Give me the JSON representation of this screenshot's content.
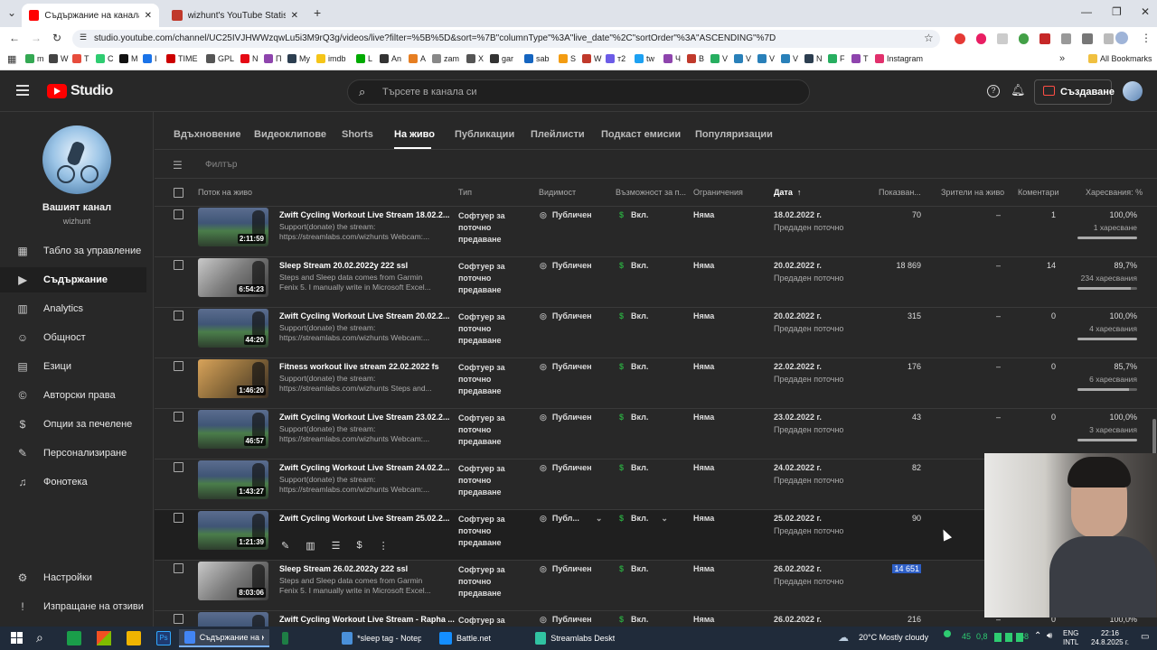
{
  "browser": {
    "tabs": [
      {
        "title": "Съдържание на канала - YouT",
        "color": "#ff0000"
      },
      {
        "title": "wizhunt's YouTube Statistics - S",
        "color": "#c0392b"
      }
    ],
    "url": "studio.youtube.com/channel/UC25IVJHWWzqwLu5i3M9rQ3g/videos/live?filter=%5B%5D&sort=%7B\"columnType\"%3A\"live_date\"%2C\"sortOrder\"%3A\"ASCENDING\"%7D",
    "bookmarks": [
      {
        "label": "m",
        "color": "#34a853"
      },
      {
        "label": "W",
        "color": "#444"
      },
      {
        "label": "T",
        "color": "#e74c3c"
      },
      {
        "label": "C",
        "color": "#2ecc71"
      },
      {
        "label": "M",
        "color": "#111"
      },
      {
        "label": "I",
        "color": "#1a73e8"
      },
      {
        "label": "TIME",
        "color": "#c00"
      },
      {
        "label": "GPL",
        "color": "#555"
      },
      {
        "label": "N",
        "color": "#e50914"
      },
      {
        "label": "П",
        "color": "#8e44ad"
      },
      {
        "label": "My",
        "color": "#2c3e50"
      },
      {
        "label": "imdb",
        "color": "#f5c518"
      },
      {
        "label": "L",
        "color": "#0a0"
      },
      {
        "label": "An",
        "color": "#333"
      },
      {
        "label": "A",
        "color": "#e67e22"
      },
      {
        "label": "zam",
        "color": "#888"
      },
      {
        "label": "X",
        "color": "#555"
      },
      {
        "label": "gar",
        "color": "#333"
      },
      {
        "label": "sab",
        "color": "#1565c0"
      },
      {
        "label": "S",
        "color": "#f39c12"
      },
      {
        "label": "W",
        "color": "#c0392b"
      },
      {
        "label": "т2",
        "color": "#6c5ce7"
      },
      {
        "label": "tw",
        "color": "#1da1f2"
      },
      {
        "label": "Ч",
        "color": "#8e44ad"
      },
      {
        "label": "В",
        "color": "#c0392b"
      },
      {
        "label": "V",
        "color": "#27ae60"
      },
      {
        "label": "V",
        "color": "#2980b9"
      },
      {
        "label": "V",
        "color": "#2980b9"
      },
      {
        "label": "V",
        "color": "#2980b9"
      },
      {
        "label": "N",
        "color": "#2c3e50"
      },
      {
        "label": "F",
        "color": "#27ae60"
      },
      {
        "label": "T",
        "color": "#8e44ad"
      },
      {
        "label": "Instagram",
        "color": "#e1306c"
      }
    ],
    "all_bookmarks": "All Bookmarks"
  },
  "studio": {
    "logo": "Studio",
    "search_placeholder": "Търсете в канала си",
    "create_label": "Създаване"
  },
  "channel": {
    "title": "Вашият канал",
    "handle": "wizhunt"
  },
  "nav": [
    {
      "label": "Табло за управление",
      "icon": "▦",
      "active": false
    },
    {
      "label": "Съдържание",
      "icon": "▶",
      "active": true
    },
    {
      "label": "Analytics",
      "icon": "▥",
      "active": false
    },
    {
      "label": "Общност",
      "icon": "☺",
      "active": false
    },
    {
      "label": "Езици",
      "icon": "▤",
      "active": false
    },
    {
      "label": "Авторски права",
      "icon": "©",
      "active": false
    },
    {
      "label": "Опции за печелене",
      "icon": "$",
      "active": false
    },
    {
      "label": "Персонализиране",
      "icon": "✎",
      "active": false
    },
    {
      "label": "Фонотека",
      "icon": "♫",
      "active": false
    }
  ],
  "nav_bottom": [
    {
      "label": "Настройки",
      "icon": "⚙"
    },
    {
      "label": "Изпращане на отзиви",
      "icon": "!"
    }
  ],
  "content_tabs": [
    "Вдъхновение",
    "Видеоклипове",
    "Shorts",
    "На живо",
    "Публикации",
    "Плейлисти",
    "Подкаст емисии",
    "Популяризации"
  ],
  "active_tab": "На живо",
  "filter_placeholder": "Филтър",
  "columns": {
    "stream": "Поток на живо",
    "type": "Тип",
    "visibility": "Видимост",
    "monetization": "Възможност за п...",
    "restrictions": "Ограничения",
    "date": "Дата",
    "views": "Показван...",
    "live_viewers": "Зрители на живо",
    "comments": "Коментари",
    "likes": "Харесвания: %"
  },
  "rows": [
    {
      "title": "Zwift Cycling Workout Live Stream 18.02.2...",
      "desc": "Support(donate) the stream: https://streamlabs.com/wizhunts Webcam:...",
      "duration": "2:11:59",
      "type": "Софтуер за поточно предаване",
      "visibility": "Публичен",
      "monetization": "Вкл.",
      "restrictions": "Няма",
      "date": "18.02.2022 г.",
      "date_sub": "Предаден поточно",
      "views": "70",
      "live": "–",
      "comments": "1",
      "likes": "100,0%",
      "likes_sub": "1 харесване",
      "like_frac": 1.0,
      "thumb": "zwift"
    },
    {
      "title": "Sleep Stream 20.02.2022y 222 ssl",
      "desc": "Steps and Sleep data comes from Garmin Fenix 5. I manually write in Microsoft Excel...",
      "duration": "6:54:23",
      "type": "Софтуер за поточно предаване",
      "visibility": "Публичен",
      "monetization": "Вкл.",
      "restrictions": "Няма",
      "date": "20.02.2022 г.",
      "date_sub": "Предаден поточно",
      "views": "18 869",
      "live": "–",
      "comments": "14",
      "likes": "89,7%",
      "likes_sub": "234 харесвания",
      "like_frac": 0.897,
      "thumb": "sleep"
    },
    {
      "title": "Zwift Cycling Workout Live Stream 20.02.2...",
      "desc": "Support(donate) the stream: https://streamlabs.com/wizhunts Webcam:...",
      "duration": "44:20",
      "type": "Софтуер за поточно предаване",
      "visibility": "Публичен",
      "monetization": "Вкл.",
      "restrictions": "Няма",
      "date": "20.02.2022 г.",
      "date_sub": "Предаден поточно",
      "views": "315",
      "live": "–",
      "comments": "0",
      "likes": "100,0%",
      "likes_sub": "4 харесвания",
      "like_frac": 1.0,
      "thumb": "zwift"
    },
    {
      "title": "Fitness workout live stream 22.02.2022 fs",
      "desc": "Support(donate) the stream: https://streamlabs.com/wizhunts Steps and...",
      "duration": "1:46:20",
      "type": "Софтуер за поточно предаване",
      "visibility": "Публичен",
      "monetization": "Вкл.",
      "restrictions": "Няма",
      "date": "22.02.2022 г.",
      "date_sub": "Предаден поточно",
      "views": "176",
      "live": "–",
      "comments": "0",
      "likes": "85,7%",
      "likes_sub": "6 харесвания",
      "like_frac": 0.857,
      "thumb": "fitness"
    },
    {
      "title": "Zwift Cycling Workout Live Stream 23.02.2...",
      "desc": "Support(donate) the stream: https://streamlabs.com/wizhunts Webcam:...",
      "duration": "46:57",
      "type": "Софтуер за поточно предаване",
      "visibility": "Публичен",
      "monetization": "Вкл.",
      "restrictions": "Няма",
      "date": "23.02.2022 г.",
      "date_sub": "Предаден поточно",
      "views": "43",
      "live": "–",
      "comments": "0",
      "likes": "100,0%",
      "likes_sub": "3 харесвания",
      "like_frac": 1.0,
      "thumb": "zwift"
    },
    {
      "title": "Zwift Cycling Workout Live Stream 24.02.2...",
      "desc": "Support(donate) the stream: https://streamlabs.com/wizhunts Webcam:...",
      "duration": "1:43:27",
      "type": "Софтуер за поточно предаване",
      "visibility": "Публичен",
      "monetization": "Вкл.",
      "restrictions": "Няма",
      "date": "24.02.2022 г.",
      "date_sub": "Предаден поточно",
      "views": "82",
      "live": "",
      "comments": "",
      "likes": "",
      "likes_sub": "",
      "like_frac": null,
      "thumb": "zwift"
    },
    {
      "title": "Zwift Cycling Workout Live Stream 25.02.2...",
      "desc": "",
      "duration": "1:21:39",
      "type": "Софтуер за поточно предаване",
      "visibility": "Публ...",
      "monetization": "Вкл.",
      "restrictions": "Няма",
      "date": "25.02.2022 г.",
      "date_sub": "Предаден поточно",
      "views": "90",
      "live": "",
      "comments": "",
      "likes": "",
      "likes_sub": "",
      "like_frac": null,
      "thumb": "zwift",
      "hover": true
    },
    {
      "title": "Sleep Stream 26.02.2022y 222 ssl",
      "desc": "Steps and Sleep data comes from Garmin Fenix 5. I manually write in Microsoft Excel...",
      "duration": "8:03:06",
      "type": "Софтуер за поточно предаване",
      "visibility": "Публичен",
      "monetization": "Вкл.",
      "restrictions": "Няма",
      "date": "26.02.2022 г.",
      "date_sub": "Предаден поточно",
      "views": "14 651",
      "live": "",
      "comments": "",
      "likes": "",
      "likes_sub": "",
      "like_frac": null,
      "thumb": "sleep",
      "selected": true
    },
    {
      "title": "Zwift Cycling Workout Live Stream - Rapha ...",
      "desc": "",
      "duration": "",
      "type": "Софтуер за",
      "visibility": "Публичен",
      "monetization": "Вкл.",
      "restrictions": "Няма",
      "date": "26.02.2022 г.",
      "date_sub": "",
      "views": "216",
      "live": "–",
      "comments": "0",
      "likes": "100,0%",
      "likes_sub": "",
      "like_frac": null,
      "thumb": "zwift"
    }
  ],
  "taskbar": {
    "items": [
      {
        "label": "Съдържание на ка...",
        "color": "#4285f4",
        "active": true
      },
      {
        "label": "",
        "color": "#1e7e45",
        "active": false
      },
      {
        "label": "*sleep tag - Notepad",
        "color": "#4a90d9",
        "active": false
      },
      {
        "label": "Battle.net",
        "color": "#148eff",
        "active": false
      },
      {
        "label": "Streamlabs Desktop",
        "color": "#31c3a2",
        "active": false
      }
    ],
    "weather": "20°C  Mostly cloudy",
    "lang": "ENG",
    "lang2": "INTL",
    "time": "22:16",
    "date": "24.8.2025 г.",
    "tray_nums": [
      "45",
      "0,8",
      "58"
    ]
  }
}
